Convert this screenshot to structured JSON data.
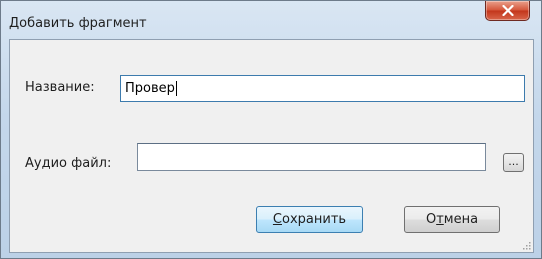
{
  "window": {
    "title": "Добавить фрагмент"
  },
  "form": {
    "name_label": "Название:",
    "name_value": "Провер",
    "audio_label": "Аудио файл:",
    "audio_value": "",
    "browse_label": "..."
  },
  "buttons": {
    "save_access_key": "С",
    "save_rest": "охранить",
    "cancel_prefix": "О",
    "cancel_access_key": "т",
    "cancel_rest": "мена"
  },
  "colors": {
    "accent": "#3c7fb1",
    "close_button": "#c3361c"
  }
}
